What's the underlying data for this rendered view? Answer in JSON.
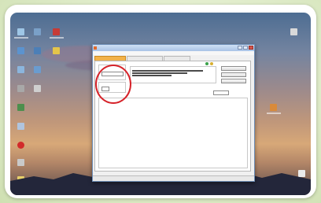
{
  "colors": {
    "frame": "#ffffff",
    "highlight_circle": "#d6232a",
    "active_tab": "#f2b24a",
    "window_border": "#6f8fb7"
  },
  "window": {
    "title": "",
    "menu": "",
    "tabs": [
      "",
      "",
      ""
    ],
    "active_tab_index": 0,
    "controls": [
      "minimize",
      "maximize",
      "close"
    ]
  },
  "desktop": {
    "icons": [
      "calculator-icon",
      "app-icon",
      "folder-icon",
      "document-icon",
      "recycle-bin-icon"
    ]
  }
}
